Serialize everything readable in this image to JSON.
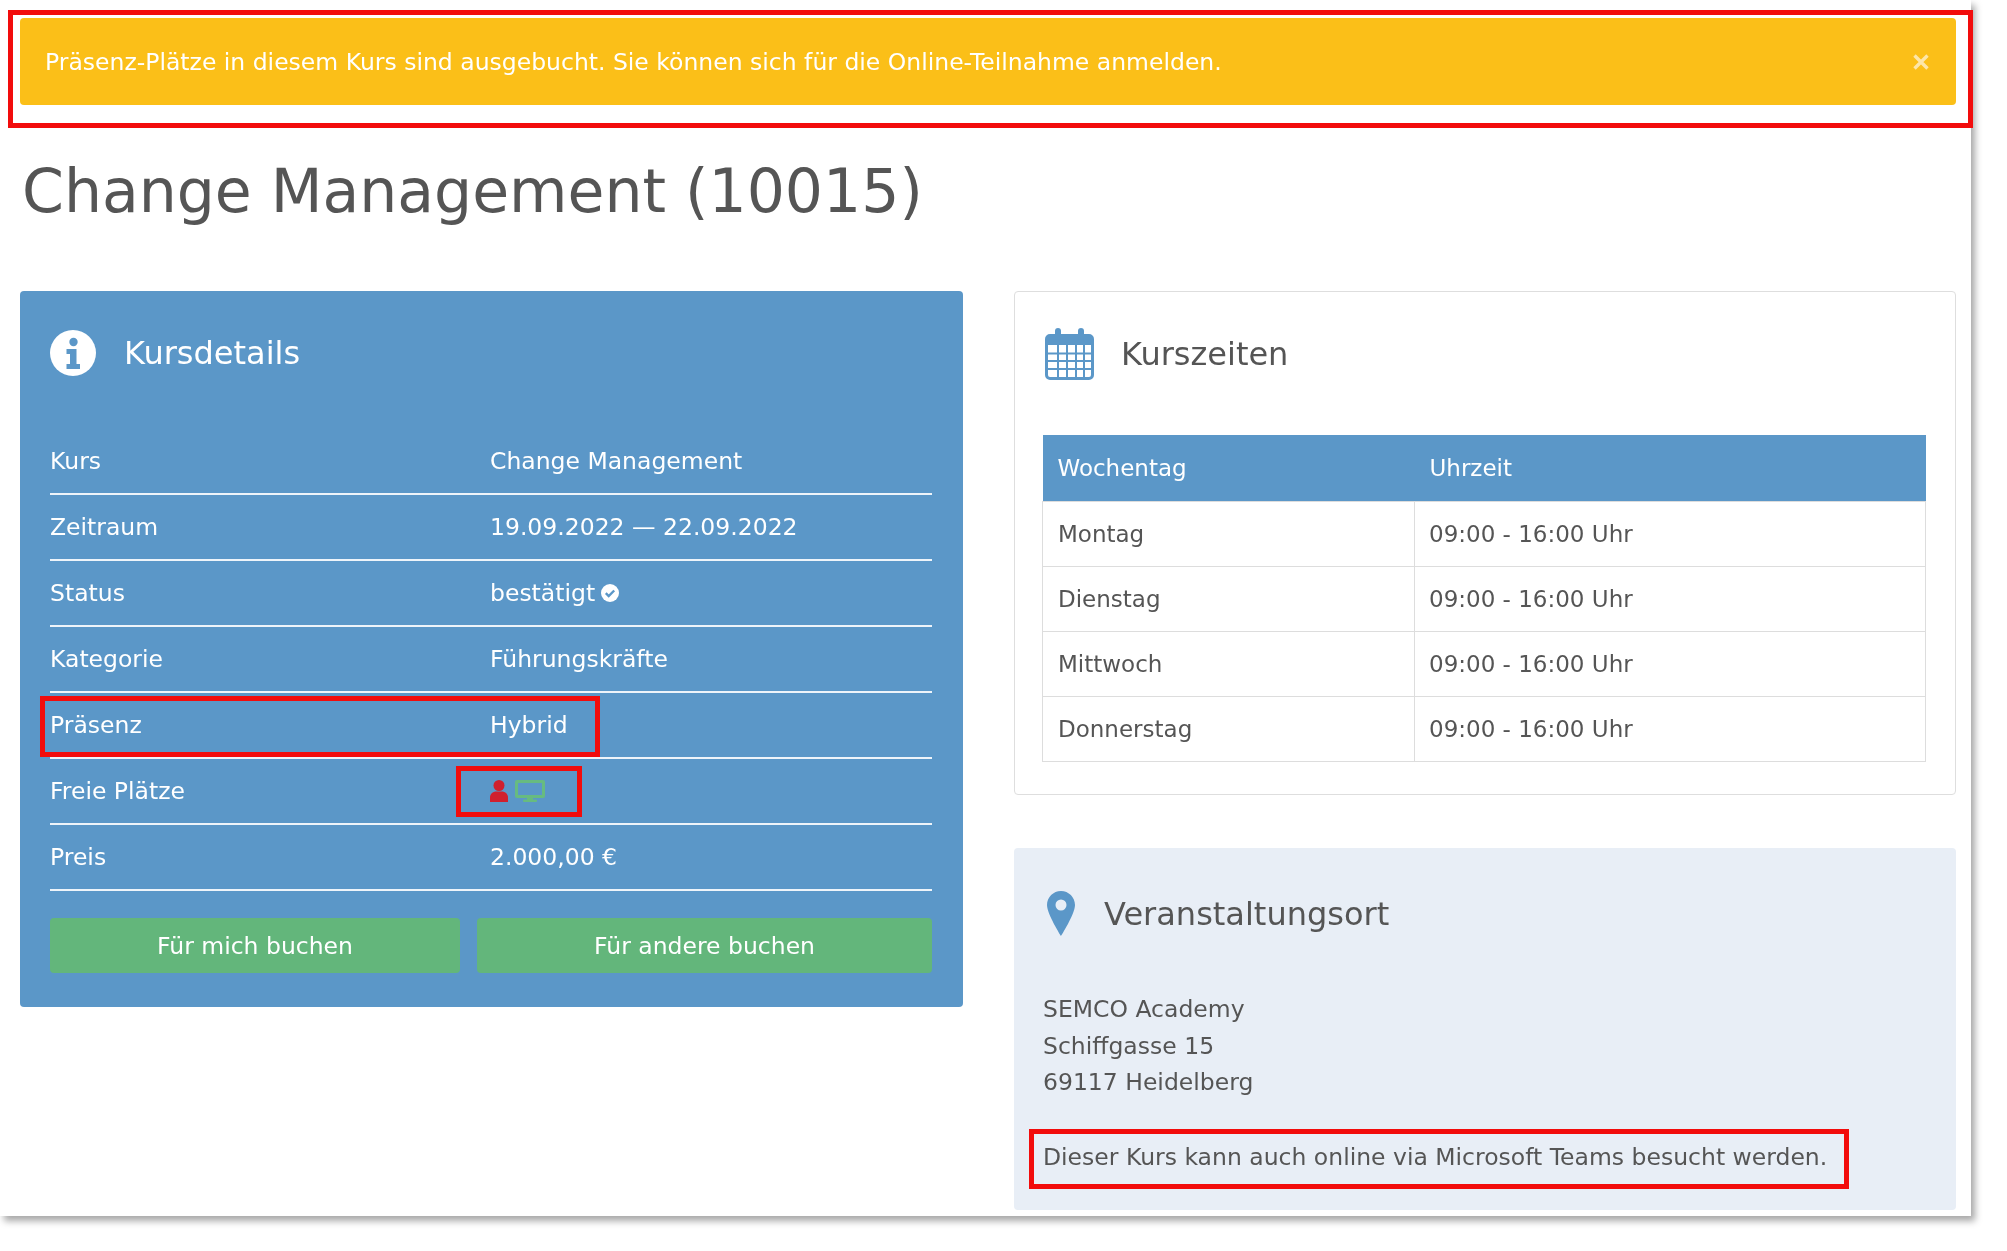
{
  "alert": {
    "message": "Präsenz-Plätze in diesem Kurs sind ausgebucht. Sie können sich für die Online-Teilnahme anmelden.",
    "dismissible": true,
    "highlighted": true
  },
  "title": "Change Management (10015)",
  "course_details": {
    "heading": "Kursdetails",
    "rows": [
      {
        "kind": "text",
        "label": "Kurs",
        "value": "Change Management",
        "highlighted": false
      },
      {
        "kind": "text",
        "label": "Zeitraum",
        "value": "19.09.2022 — 22.09.2022",
        "highlighted": false
      },
      {
        "kind": "status",
        "label": "Status",
        "value": "bestätigt",
        "confirmed": true,
        "highlighted": false
      },
      {
        "kind": "text",
        "label": "Kategorie",
        "value": "Führungskräfte",
        "highlighted": false
      },
      {
        "kind": "text",
        "label": "Präsenz",
        "value": "Hybrid",
        "highlighted": true
      },
      {
        "kind": "seats",
        "label": "Freie Plätze",
        "seats": [
          {
            "kind": "in_person",
            "available": false
          },
          {
            "kind": "online",
            "available": true
          }
        ],
        "highlighted": true
      },
      {
        "kind": "text",
        "label": "Preis",
        "value": "2.000,00 €",
        "highlighted": false
      }
    ],
    "buttons": [
      "Für mich buchen",
      "Für andere buchen"
    ]
  },
  "course_times": {
    "heading": "Kurszeiten",
    "columns": [
      "Wochentag",
      "Uhrzeit"
    ],
    "rows": [
      [
        "Montag",
        "09:00 - 16:00 Uhr"
      ],
      [
        "Dienstag",
        "09:00 - 16:00 Uhr"
      ],
      [
        "Mittwoch",
        "09:00 - 16:00 Uhr"
      ],
      [
        "Donnerstag",
        "09:00 - 16:00 Uhr"
      ]
    ]
  },
  "location": {
    "heading": "Veranstaltungsort",
    "address": [
      "SEMCO Academy",
      "Schiffgasse 15",
      "69117 Heidelberg"
    ],
    "note": {
      "text": "Dieser Kurs kann auch online via Microsoft Teams besucht werden.",
      "highlighted": true
    }
  }
}
